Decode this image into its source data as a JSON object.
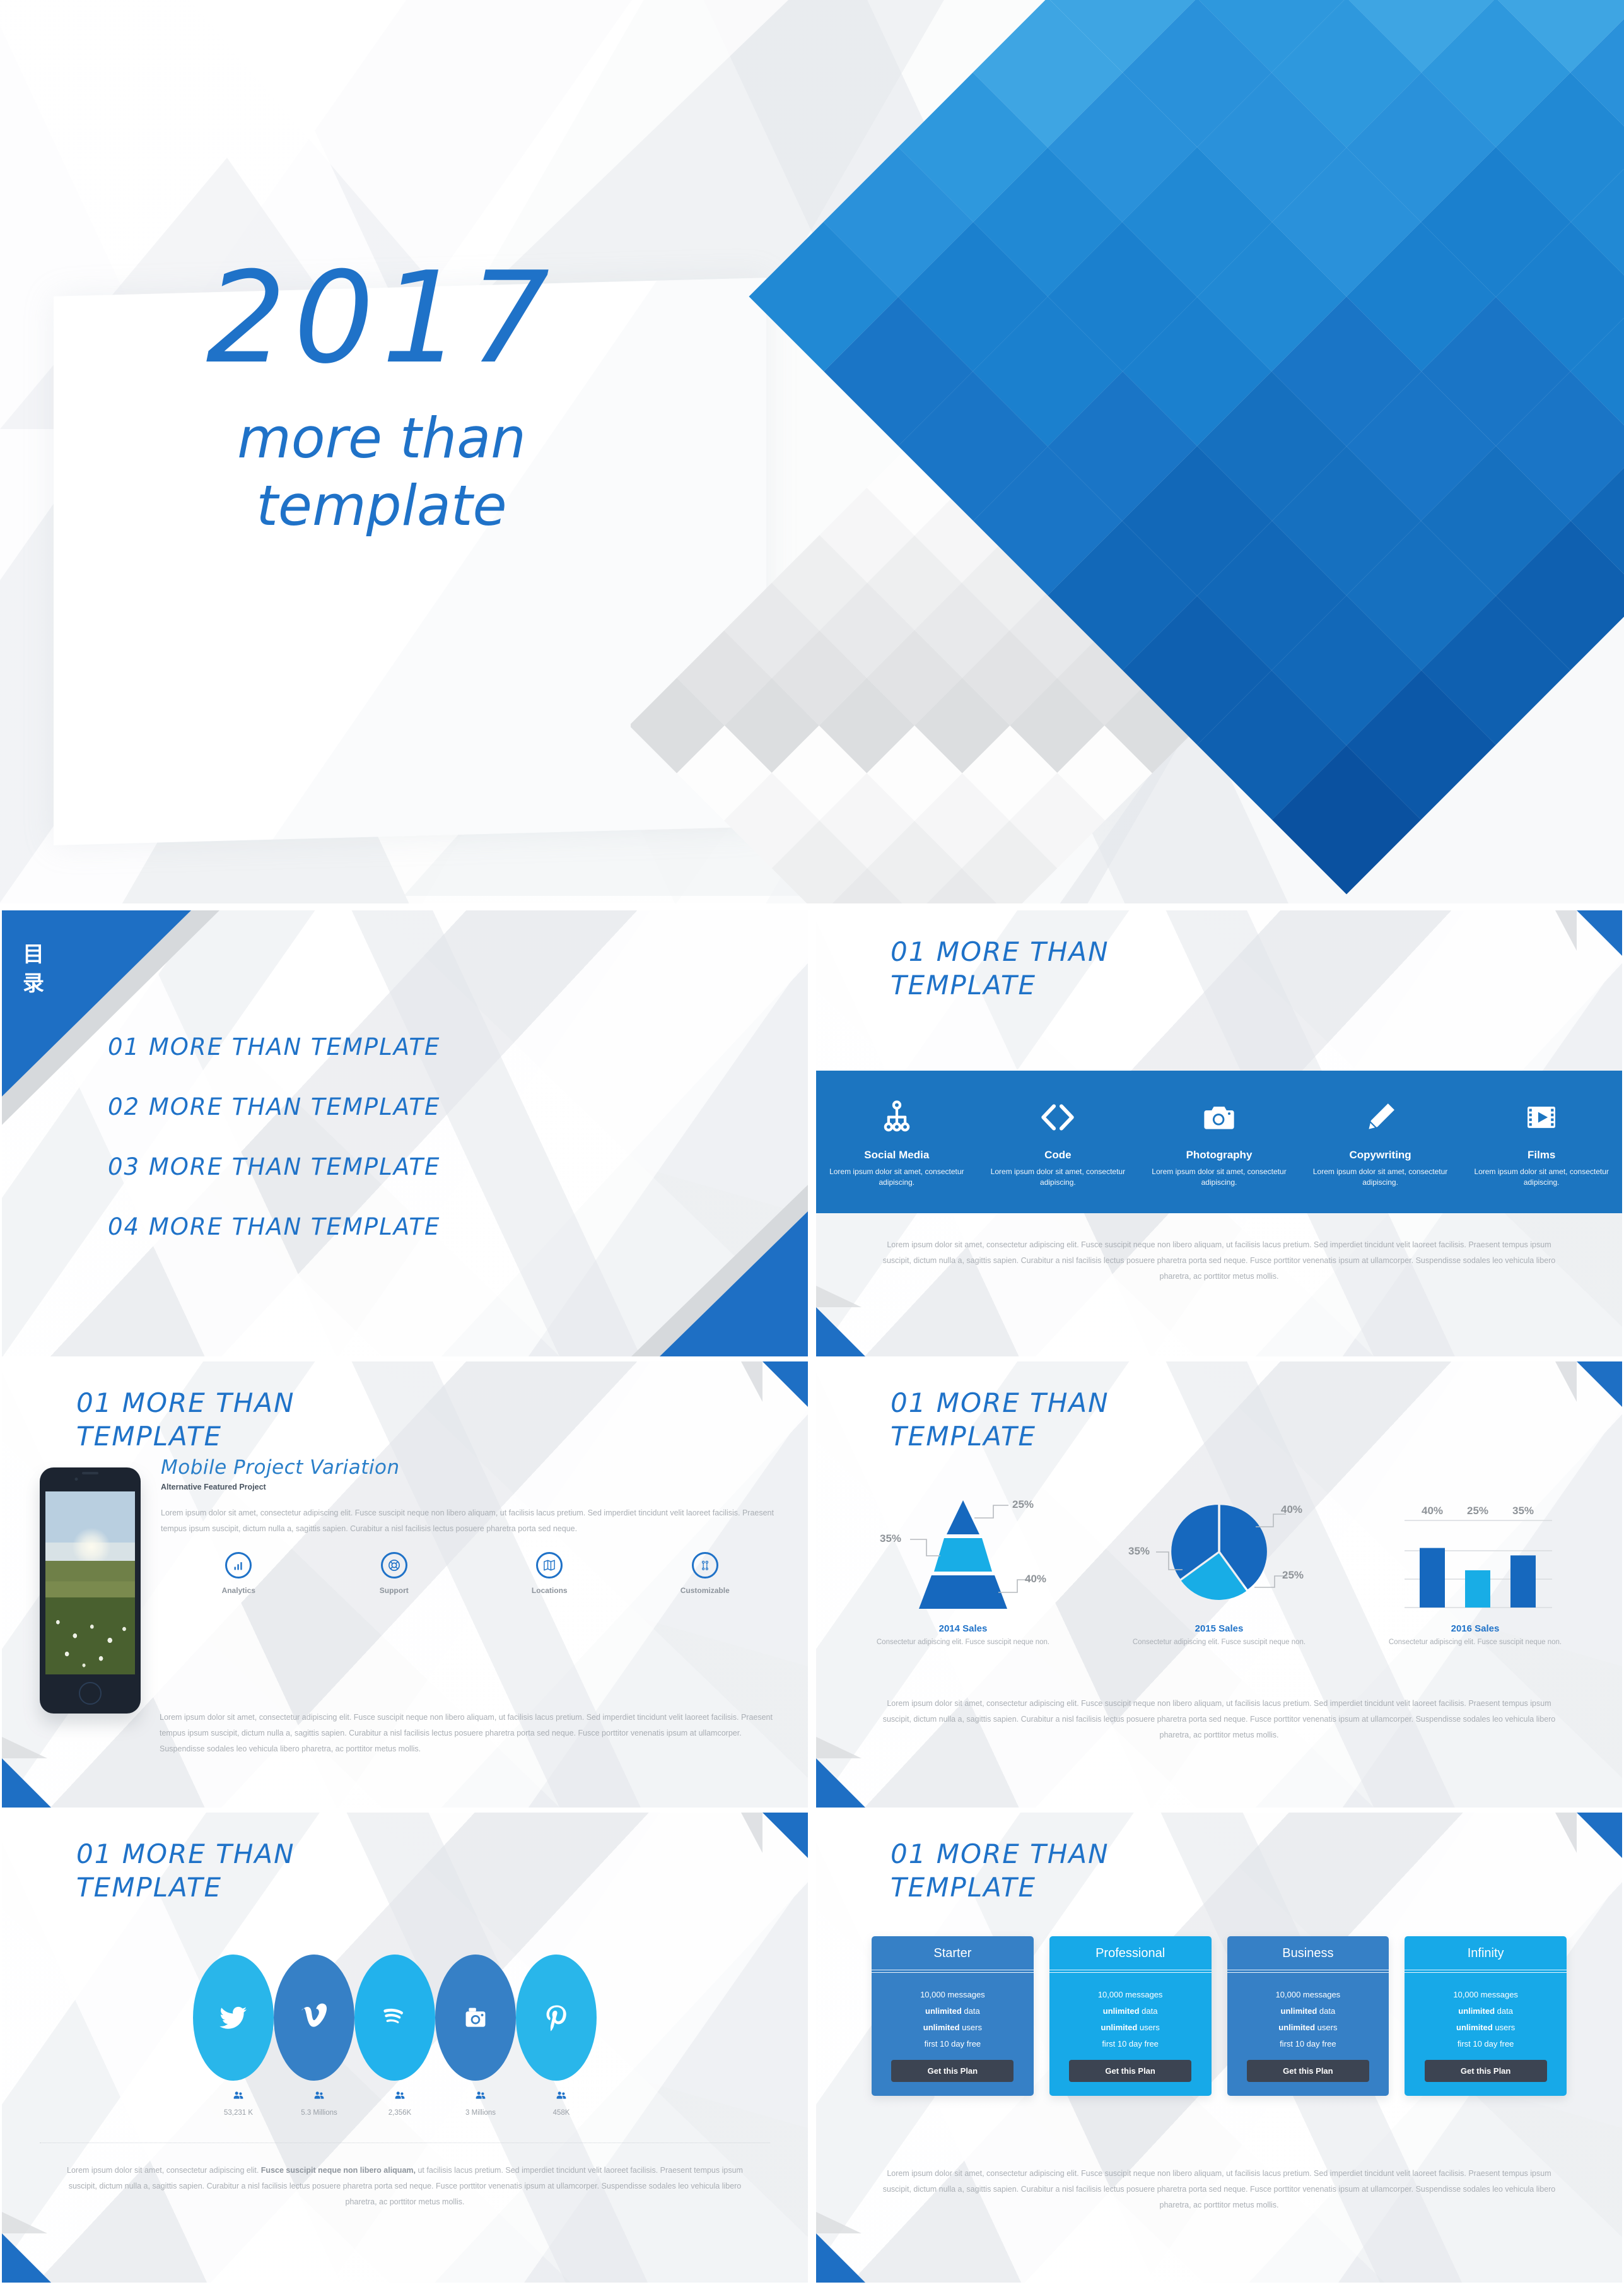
{
  "title_slide": {
    "year": "2017",
    "subtitle_line1": "more than",
    "subtitle_line2": "template",
    "accent_color": "#1f72c8"
  },
  "toc": {
    "label": "目录",
    "items": [
      "01 MORE THAN TEMPLATE",
      "02 MORE THAN TEMPLATE",
      "03 MORE THAN TEMPLATE",
      "04 MORE THAN TEMPLATE"
    ]
  },
  "common": {
    "slide_title": "01 MORE THAN\nTEMPLATE",
    "footer_paragraph": "Lorem ipsum dolor sit amet, consectetur adipiscing elit. Fusce suscipit neque non libero aliquam, ut facilisis lacus pretium. Sed imperdiet tincidunt velit laoreet facilisis. Praesent tempus ipsum suscipit, dictum nulla a, sagittis sapien. Curabitur a nisl facilisis lectus posuere pharetra porta sed neque. Fusce porttitor venenatis ipsum at ullamcorper. Suspendisse sodales leo vehicula libero pharetra, ac porttitor metus mollis.",
    "band_color": "#1c75c0"
  },
  "icons_slide": {
    "features": [
      {
        "icon": "sitemap-icon",
        "title": "Social Media",
        "desc": "Lorem ipsum dolor sit amet, consectetur adipiscing."
      },
      {
        "icon": "code-icon",
        "title": "Code",
        "desc": "Lorem ipsum dolor sit amet, consectetur adipiscing."
      },
      {
        "icon": "camera-icon",
        "title": "Photography",
        "desc": "Lorem ipsum dolor sit amet, consectetur adipiscing."
      },
      {
        "icon": "pencil-icon",
        "title": "Copywriting",
        "desc": "Lorem ipsum dolor sit amet, consectetur adipiscing."
      },
      {
        "icon": "film-strip-icon",
        "title": "Films",
        "desc": "Lorem ipsum dolor sit amet, consectetur adipiscing."
      }
    ]
  },
  "mobile_slide": {
    "heading": "Mobile Project Variation",
    "subheading": "Alternative Featured Project",
    "paragraph": "Lorem ipsum dolor sit amet, consectetur adipiscing elit. Fusce suscipit neque non libero aliquam, ut facilisis lacus pretium. Sed imperdiet tincidunt velit laoreet facilisis. Praesent tempus ipsum suscipit, dictum nulla a, sagittis sapien. Curabitur a nisl facilisis lectus posuere pharetra porta sed neque.",
    "features": [
      {
        "icon": "bar-chart-icon",
        "label": "Analytics"
      },
      {
        "icon": "lifebuoy-icon",
        "label": "Support"
      },
      {
        "icon": "map-icon",
        "label": "Locations"
      },
      {
        "icon": "sliders-icon",
        "label": "Customizable"
      }
    ]
  },
  "charts_slide": {
    "charts": [
      {
        "title": "2014 Sales",
        "desc": "Consectetur adipiscing elit. Fusce suscipit neque non."
      },
      {
        "title": "2015 Sales",
        "desc": "Consectetur adipiscing elit. Fusce suscipit neque non."
      },
      {
        "title": "2016 Sales",
        "desc": "Consectetur adipiscing elit. Fusce suscipit neque non."
      }
    ]
  },
  "chart_data": [
    {
      "type": "pie",
      "title": "2014 Sales",
      "subtype": "pyramid",
      "labels": [
        "25%",
        "35%",
        "40%"
      ],
      "values": [
        25,
        35,
        40
      ],
      "segment_order_top_to_bottom": [
        "25%",
        "35%",
        "40%"
      ],
      "colors": [
        "#1668be",
        "#18ade6",
        "#1668be"
      ],
      "legend": "none",
      "annotations": [
        "25%",
        "35%",
        "40%"
      ]
    },
    {
      "type": "pie",
      "title": "2015 Sales",
      "labels": [
        "40%",
        "25%",
        "35%"
      ],
      "values": [
        40,
        25,
        35
      ],
      "colors": [
        "#1668be",
        "#18ade6",
        "#1668be"
      ],
      "legend": "none",
      "annotations": [
        "40%",
        "25%",
        "35%"
      ]
    },
    {
      "type": "bar",
      "title": "2016 Sales",
      "categories": [
        "40%",
        "25%",
        "35%"
      ],
      "values": [
        40,
        25,
        35
      ],
      "colors": [
        "#1668be",
        "#18ade6",
        "#1668be"
      ],
      "ylim": [
        0,
        50
      ],
      "grid": true,
      "xlabel": "",
      "ylabel": "",
      "legend": "none"
    }
  ],
  "social_slide": {
    "networks": [
      {
        "icon": "twitter-icon",
        "count": "53,231 K",
        "color": "#29b6ea"
      },
      {
        "icon": "vimeo-icon",
        "count": "5.3 Millions",
        "color": "#3680c6"
      },
      {
        "icon": "spotify-icon",
        "count": "2,356K",
        "color": "#22b2ec"
      },
      {
        "icon": "instagram-icon",
        "count": "3 Millions",
        "color": "#3680c6"
      },
      {
        "icon": "pinterest-icon",
        "count": "458K",
        "color": "#29b6ea"
      }
    ],
    "footer_bold_phrase": "Fusce suscipit neque non libero aliquam,",
    "footer_part1": "Lorem ipsum dolor sit amet, consectetur adipiscing elit. ",
    "footer_part2": " ut facilisis lacus pretium. Sed imperdiet tincidunt velit laoreet facilisis. Praesent tempus ipsum suscipit, dictum nulla a, sagittis sapien. Curabitur a nisl facilisis lectus posuere pharetra porta sed neque. Fusce porttitor venenatis ipsum at ullamcorper. Suspendisse sodales leo vehicula libero pharetra, ac porttitor metus mollis."
  },
  "pricing_slide": {
    "button_label": "Get this Plan",
    "plans": [
      {
        "name": "Starter",
        "color": "#3680c6",
        "features": [
          "10,000 messages",
          "unlimited|data",
          "unlimited|users",
          "first 10 day free"
        ]
      },
      {
        "name": "Professional",
        "color": "#17a9e8",
        "features": [
          "10,000 messages",
          "unlimited|data",
          "unlimited|users",
          "first 10 day free"
        ]
      },
      {
        "name": "Business",
        "color": "#3680c6",
        "features": [
          "10,000 messages",
          "unlimited|data",
          "unlimited|users",
          "first 10 day free"
        ]
      },
      {
        "name": "Infinity",
        "color": "#17a9e8",
        "features": [
          "10,000 messages",
          "unlimited|data",
          "unlimited|users",
          "first 10 day free"
        ]
      }
    ]
  }
}
